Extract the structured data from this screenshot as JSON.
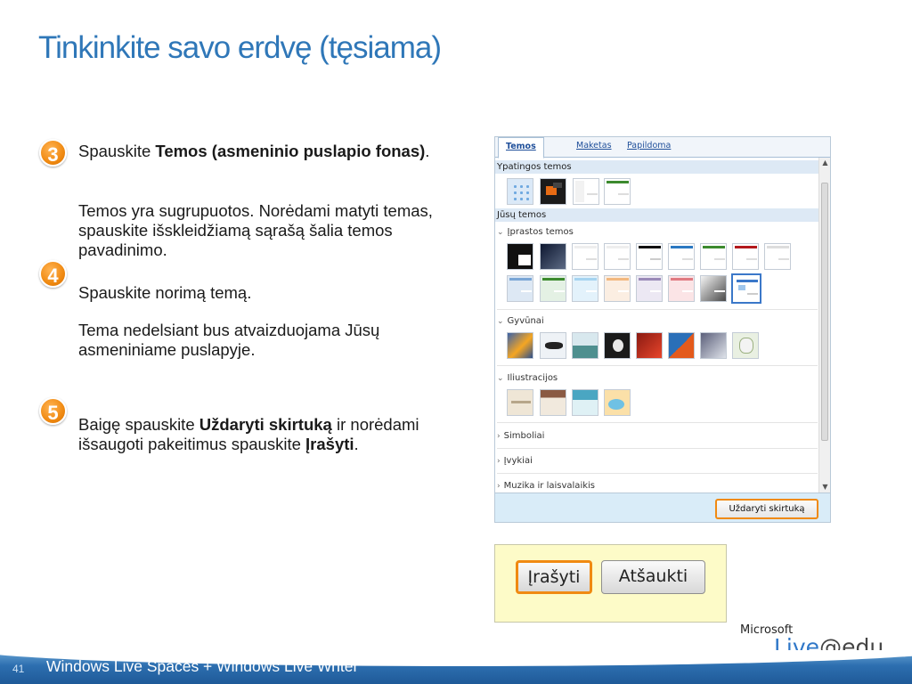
{
  "slide": {
    "title": "Tinkinkite savo erdvę (tęsiama)",
    "page_number": "41",
    "footer_text": "Windows Live Spaces + Windows Live Writer"
  },
  "steps": {
    "s3": "3",
    "s4": "4",
    "s5": "5"
  },
  "text": {
    "p1_pre": "Spauskite ",
    "p1_bold": "Temos (asmeninio puslapio fonas)",
    "p1_post": ".",
    "p2": "Temos yra sugrupuotos. Norėdami matyti temas, spauskite išskleidžiamą sąrašą šalia temos pavadinimo.",
    "p3": "Spauskite norimą temą.",
    "p4": "Tema nedelsiant bus atvaizduojama Jūsų asmeniniame puslapyje.",
    "p5_pre": "Baigę spauskite ",
    "p5_bold1": "Uždaryti skirtuką",
    "p5_mid": " ir norėdami išsaugoti pakeitimus spauskite ",
    "p5_bold2": "Įrašyti",
    "p5_post": "."
  },
  "panel": {
    "tabs": [
      "Temos",
      "Maketas",
      "Papildoma"
    ],
    "special_themes": "Ypatingos temos",
    "your_themes": "Jūsų temos",
    "groups": {
      "usual": "Įprastos temos",
      "animals": "Gyvūnai",
      "illustrations": "Iliustracijos",
      "symbols": "Simboliai",
      "events": "Įvykiai",
      "music": "Muzika ir laisvalaikis"
    },
    "close_tab": "Uždaryti skirtuką"
  },
  "buttons": {
    "save": "Įrašyti",
    "cancel": "Atšaukti"
  },
  "logo": {
    "microsoft": "Microsoft",
    "live": "Live",
    "edu": "@edu"
  },
  "colors": {
    "title": "#2f77b8",
    "accent_orange": "#f08a12",
    "section_header": "#dde9f5",
    "savebox": "#fdfbc8"
  }
}
